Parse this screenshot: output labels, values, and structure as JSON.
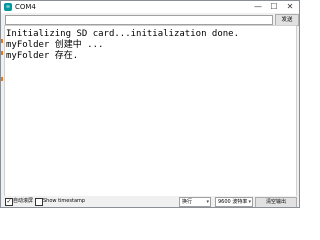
{
  "window": {
    "title": "COM4",
    "app_icon": "arduino-icon"
  },
  "title_controls": {
    "minimize": "—",
    "maximize": "☐",
    "close": "✕"
  },
  "toolbar": {
    "send_input_value": "",
    "send_label": "发送"
  },
  "output": {
    "lines": [
      "Initializing SD card...initialization done.",
      "myFolder 创建中 ...",
      "myFolder 存在."
    ]
  },
  "statusbar": {
    "autoscroll_label": "自动滚屏",
    "autoscroll_checked": true,
    "timestamp_label": "Show timestamp",
    "timestamp_checked": false,
    "line_ending": "换行",
    "baud_rate": "9600 波特率",
    "clear_label": "清空输出"
  },
  "colors": {
    "accent": "#00979d",
    "side_marks": "#e07820"
  }
}
